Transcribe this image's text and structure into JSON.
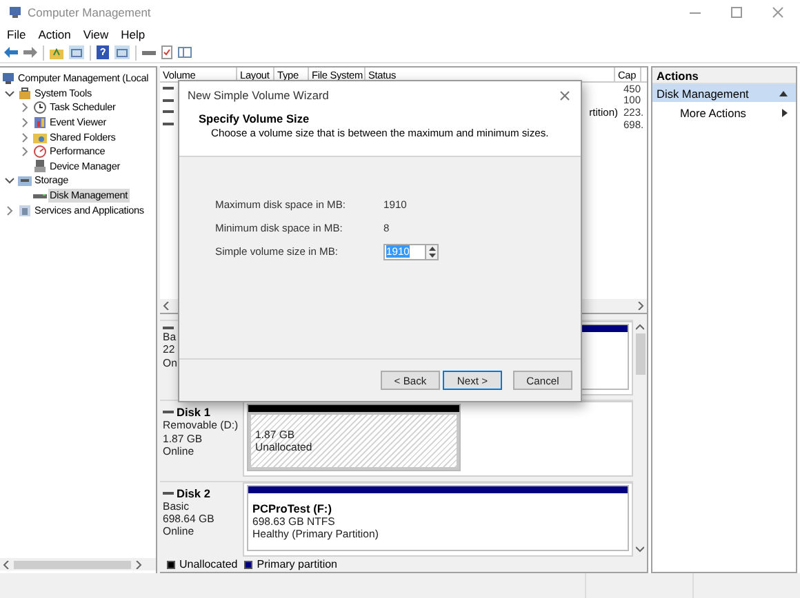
{
  "window": {
    "title": "Computer Management"
  },
  "menu": [
    "File",
    "Action",
    "View",
    "Help"
  ],
  "tree": [
    {
      "label": "Computer Management (Local",
      "selected": false,
      "children": [
        {
          "label": "System Tools",
          "expanded": true,
          "selected": false,
          "children": [
            {
              "label": "Task Scheduler",
              "expanded": false,
              "selected": false
            },
            {
              "label": "Event Viewer",
              "expanded": false,
              "selected": false
            },
            {
              "label": "Shared Folders",
              "expanded": false,
              "selected": false
            },
            {
              "label": "Performance",
              "expanded": false,
              "selected": false
            },
            {
              "label": "Device Manager",
              "selected": false
            }
          ]
        },
        {
          "label": "Storage",
          "expanded": true,
          "selected": false,
          "children": [
            {
              "label": "Disk Management",
              "selected": true
            }
          ]
        },
        {
          "label": "Services and Applications",
          "expanded": false,
          "selected": false
        }
      ]
    }
  ],
  "volume_list": {
    "columns": [
      "Volume",
      "Layout",
      "Type",
      "File System",
      "Status",
      "Cap"
    ],
    "rows": [
      {
        "capacity": "450"
      },
      {
        "capacity": "100"
      },
      {
        "status": "rtition)",
        "capacity": "223."
      },
      {
        "capacity": "698."
      }
    ]
  },
  "disks": [
    {
      "lines": [
        "Ba",
        "22",
        "On"
      ],
      "partitions": [
        {
          "kind": "primary"
        }
      ]
    },
    {
      "name": "Disk 1",
      "lines": [
        "Removable (D:)",
        "1.87 GB",
        "Online"
      ],
      "partitions": [
        {
          "kind": "unallocated",
          "lines": [
            "1.87 GB",
            "Unallocated"
          ]
        }
      ]
    },
    {
      "name": "Disk 2",
      "lines": [
        "Basic",
        "698.64 GB",
        "Online"
      ],
      "partitions": [
        {
          "kind": "primary",
          "title": "PCProTest  (F:)",
          "lines": [
            "698.63 GB NTFS",
            "Healthy (Primary Partition)"
          ]
        }
      ]
    }
  ],
  "legend": [
    {
      "label": "Unallocated",
      "color": "#000000"
    },
    {
      "label": "Primary partition",
      "color": "#000080"
    }
  ],
  "actions": {
    "title": "Actions",
    "items": [
      {
        "label": "Disk Management",
        "kind": "section",
        "selected": true
      },
      {
        "label": "More Actions",
        "kind": "item",
        "selected": false
      }
    ]
  },
  "dialog": {
    "title": "New Simple Volume Wizard",
    "heading": "Specify Volume Size",
    "description": "Choose a volume size that is between the maximum and minimum sizes.",
    "fields": [
      {
        "kind": "text",
        "label": "Maximum disk space in MB:",
        "value": "1910"
      },
      {
        "kind": "text",
        "label": "Minimum disk space in MB:",
        "value": "8"
      },
      {
        "kind": "spin",
        "label": "Simple volume size in MB:",
        "value": "1910",
        "highlighted": true
      }
    ],
    "buttons": [
      {
        "label": "< Back",
        "default": false
      },
      {
        "label": "Next >",
        "default": true
      },
      {
        "label": "Cancel",
        "default": false
      }
    ]
  }
}
